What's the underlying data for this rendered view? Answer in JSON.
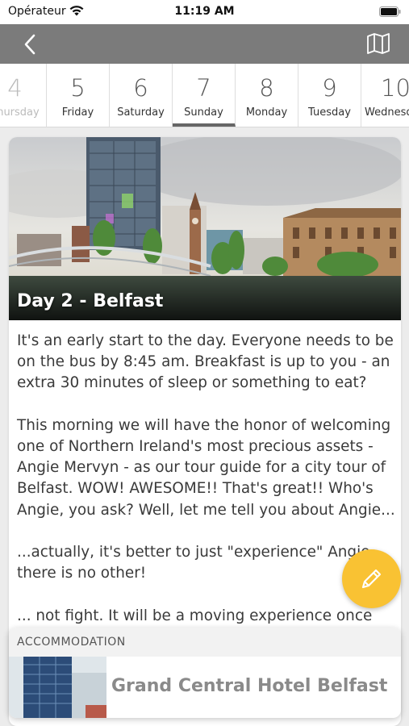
{
  "status_bar": {
    "carrier": "Opérateur",
    "time": "11:19 AM"
  },
  "nav": {
    "back_icon": "chevron-left-icon",
    "map_icon": "map-icon"
  },
  "days": [
    {
      "num": "4",
      "name": "Thursday"
    },
    {
      "num": "5",
      "name": "Friday"
    },
    {
      "num": "6",
      "name": "Saturday"
    },
    {
      "num": "7",
      "name": "Sunday"
    },
    {
      "num": "8",
      "name": "Monday"
    },
    {
      "num": "9",
      "name": "Tuesday"
    },
    {
      "num": "10",
      "name": "Wednesday"
    }
  ],
  "selected_day": "7",
  "card": {
    "title": "Day 2 - Belfast",
    "paragraphs": [
      "It's an early start to the day.  Everyone needs to be on the bus by 8:45 am.  Breakfast is up to you - an extra 30 minutes of sleep or something to eat?",
      "This morning we will have the honor of welcoming one of Northern Ireland's most precious assets - Angie Mervyn - as our tour guide for a city tour of Belfast.  WOW!  AWESOME!! That's great!!  Who's Angie, you ask?  Well, let me tell you about Angie...",
      "...actually, it's better to just \"experience\" Angie - there is no other!",
      "... not fight.  It will be a moving experience once"
    ]
  },
  "accommodation": {
    "label": "ACCOMMODATION",
    "name": "Grand Central Hotel Belfast"
  },
  "colors": {
    "nav_bar": "#7b7b7b",
    "fab": "#f9c233",
    "active_underline": "#666666"
  },
  "fab": {
    "icon": "pencil-icon"
  }
}
